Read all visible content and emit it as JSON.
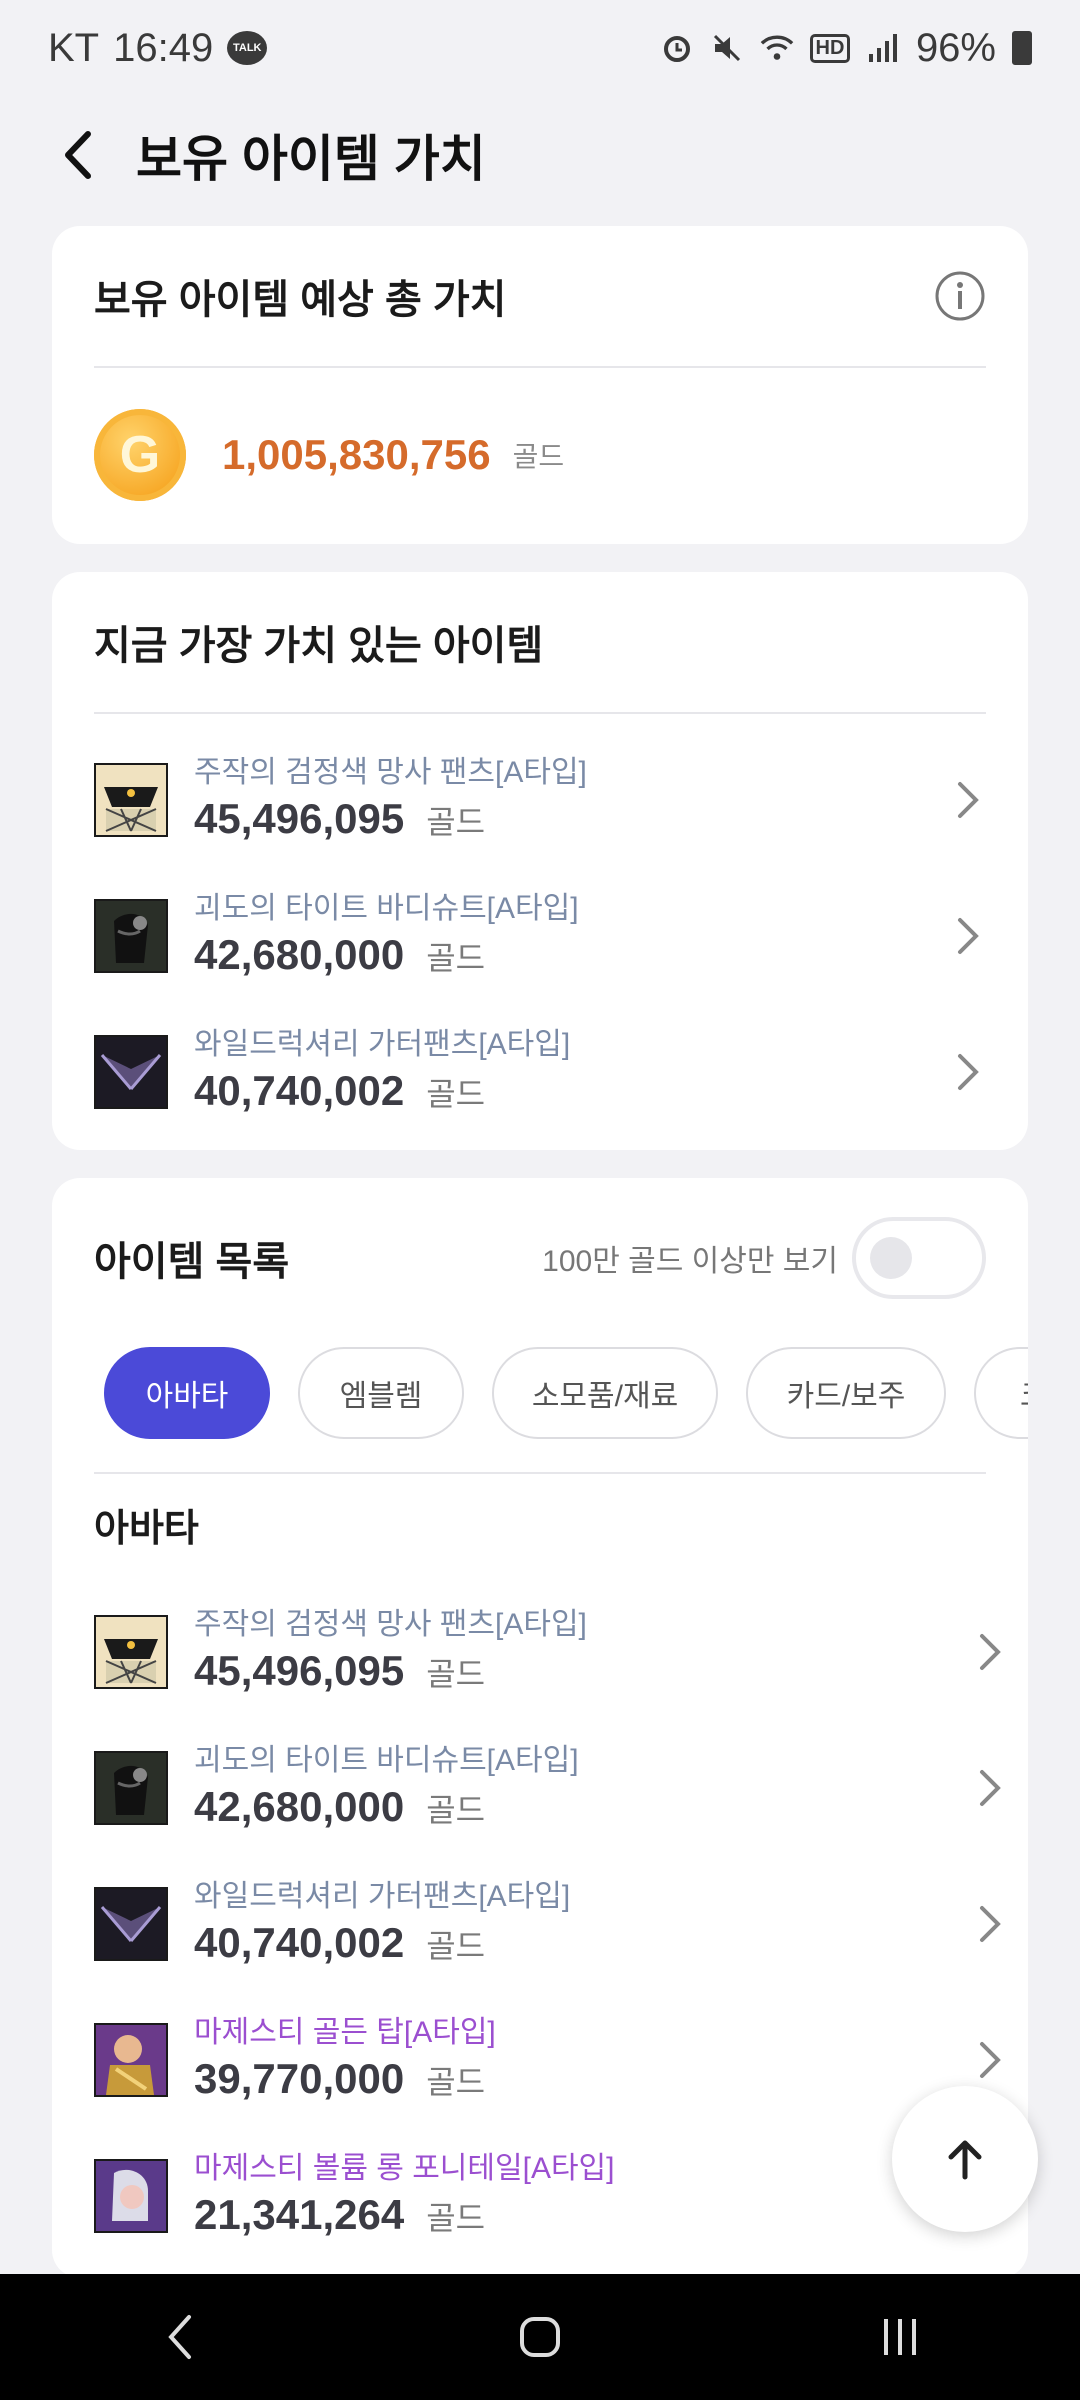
{
  "status_bar": {
    "carrier": "KT",
    "time": "16:49",
    "talk_badge": "TALK",
    "hd_label": "HD",
    "battery": "96%"
  },
  "header": {
    "title": "보유 아이템 가치"
  },
  "total_card": {
    "title": "보유 아이템 예상 총 가치",
    "coin_letter": "G",
    "value": "1,005,830,756",
    "unit": "골드"
  },
  "top_items": {
    "title": "지금 가장 가치 있는 아이템",
    "items": [
      {
        "name": "주작의 검정색 망사 팬츠[A타입]",
        "price": "45,496,095",
        "unit": "골드"
      },
      {
        "name": "괴도의 타이트 바디슈트[A타입]",
        "price": "42,680,000",
        "unit": "골드"
      },
      {
        "name": "와일드럭셔리 가터팬츠[A타입]",
        "price": "40,740,002",
        "unit": "골드"
      }
    ]
  },
  "item_list": {
    "title": "아이템 목록",
    "filter_label": "100만 골드 이상만 보기",
    "filter_on": false,
    "chips": [
      "아바타",
      "엠블렘",
      "소모품/재료",
      "카드/보주",
      "크"
    ],
    "active_chip": "아바타",
    "section": "아바타",
    "items": [
      {
        "name": "주작의 검정색 망사 팬츠[A타입]",
        "price": "45,496,095",
        "unit": "골드"
      },
      {
        "name": "괴도의 타이트 바디슈트[A타입]",
        "price": "42,680,000",
        "unit": "골드"
      },
      {
        "name": "와일드럭셔리 가터팬츠[A타입]",
        "price": "40,740,002",
        "unit": "골드"
      },
      {
        "name": "마제스티 골든 탑[A타입]",
        "price": "39,770,000",
        "unit": "골드"
      },
      {
        "name": "마제스티 볼륨 롱 포니테일[A타입]",
        "price": "21,341,264",
        "unit": "골드"
      }
    ]
  },
  "colors": {
    "accent": "#4b4ad8",
    "total_value": "#d56b2b",
    "rare_item": "#9b4fd0",
    "item_name": "#7a8aa6"
  }
}
